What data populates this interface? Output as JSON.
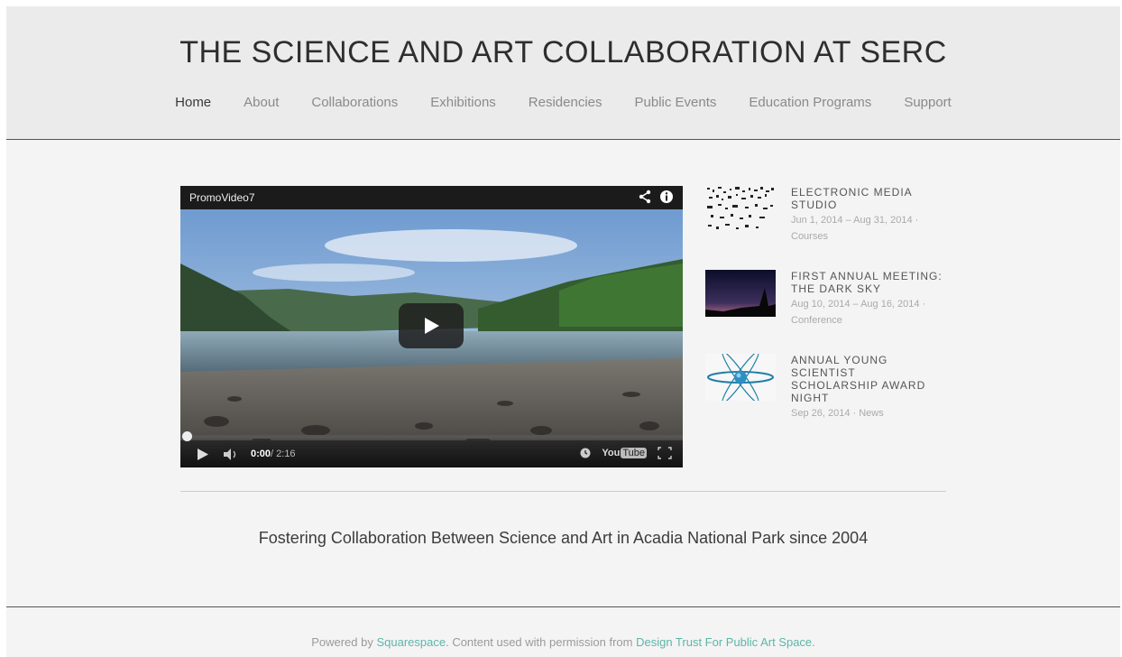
{
  "site": {
    "title": "THE SCIENCE AND ART COLLABORATION AT SERC"
  },
  "nav": {
    "items": [
      {
        "label": "Home",
        "active": true
      },
      {
        "label": "About"
      },
      {
        "label": "Collaborations"
      },
      {
        "label": "Exhibitions"
      },
      {
        "label": "Residencies"
      },
      {
        "label": "Public Events"
      },
      {
        "label": "Education Programs"
      },
      {
        "label": "Support"
      }
    ]
  },
  "video": {
    "title": "PromoVideo7",
    "current_time": "0:00",
    "duration": "/ 2:16",
    "progress_fraction": 0,
    "logo_you": "You",
    "logo_tube": "Tube",
    "icons": [
      "share-icon",
      "info-icon",
      "play-icon",
      "volume-icon",
      "clock-icon",
      "fullscreen-icon"
    ]
  },
  "events": [
    {
      "title": "ELECTRONIC MEDIA STUDIO",
      "dates": "Jun 1, 2014 – Aug 31, 2014",
      "sep": " · ",
      "category": "Courses"
    },
    {
      "title": "FIRST ANNUAL MEETING: THE DARK SKY",
      "dates": "Aug 10, 2014 – Aug 16, 2014",
      "sep": " · ",
      "category": "Conference"
    },
    {
      "title": "ANNUAL YOUNG SCIENTIST SCHOLARSHIP AWARD NIGHT",
      "dates": "Sep 26, 2014",
      "sep": " · ",
      "category": "News"
    }
  ],
  "tagline": "Fostering Collaboration Between Science and Art in Acadia National Park since 2004",
  "footer": {
    "prefix": "Powered by ",
    "squarespace": "Squarespace",
    "middle": ".  Content used with permission from ",
    "design_trust": "Design Trust For Public Art Space",
    "suffix": "."
  },
  "colors": {
    "link": "#5db6a9",
    "header_bg": "#ebebeb",
    "page_bg": "#f4f4f4"
  }
}
